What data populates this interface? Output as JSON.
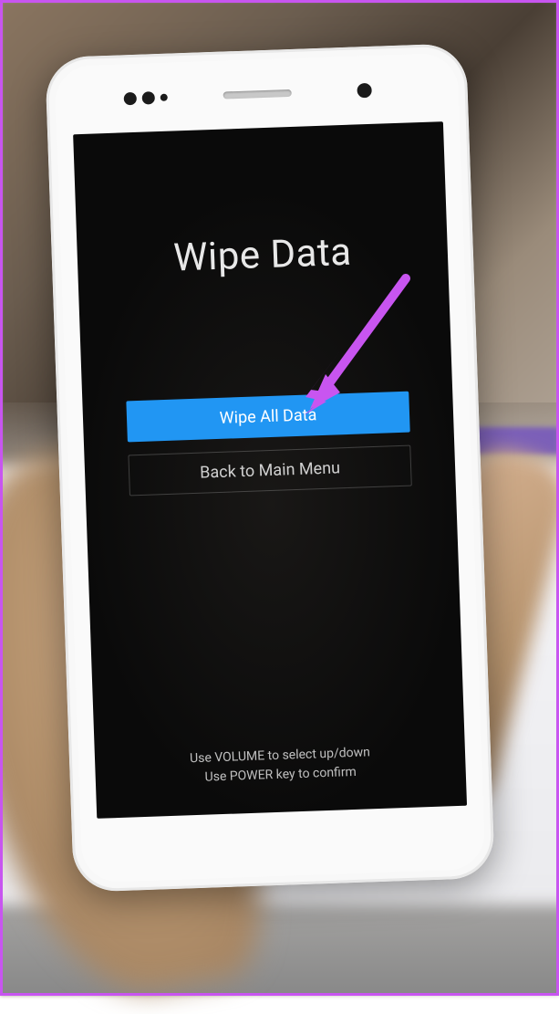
{
  "recovery": {
    "title": "Wipe Data",
    "options": [
      {
        "label": "Wipe All Data",
        "selected": true
      },
      {
        "label": "Back to Main Menu",
        "selected": false
      }
    ],
    "instruction_line1": "Use VOLUME to select up/down",
    "instruction_line2": "Use POWER key to confirm"
  },
  "annotation": {
    "arrow_color": "#c855f0"
  }
}
